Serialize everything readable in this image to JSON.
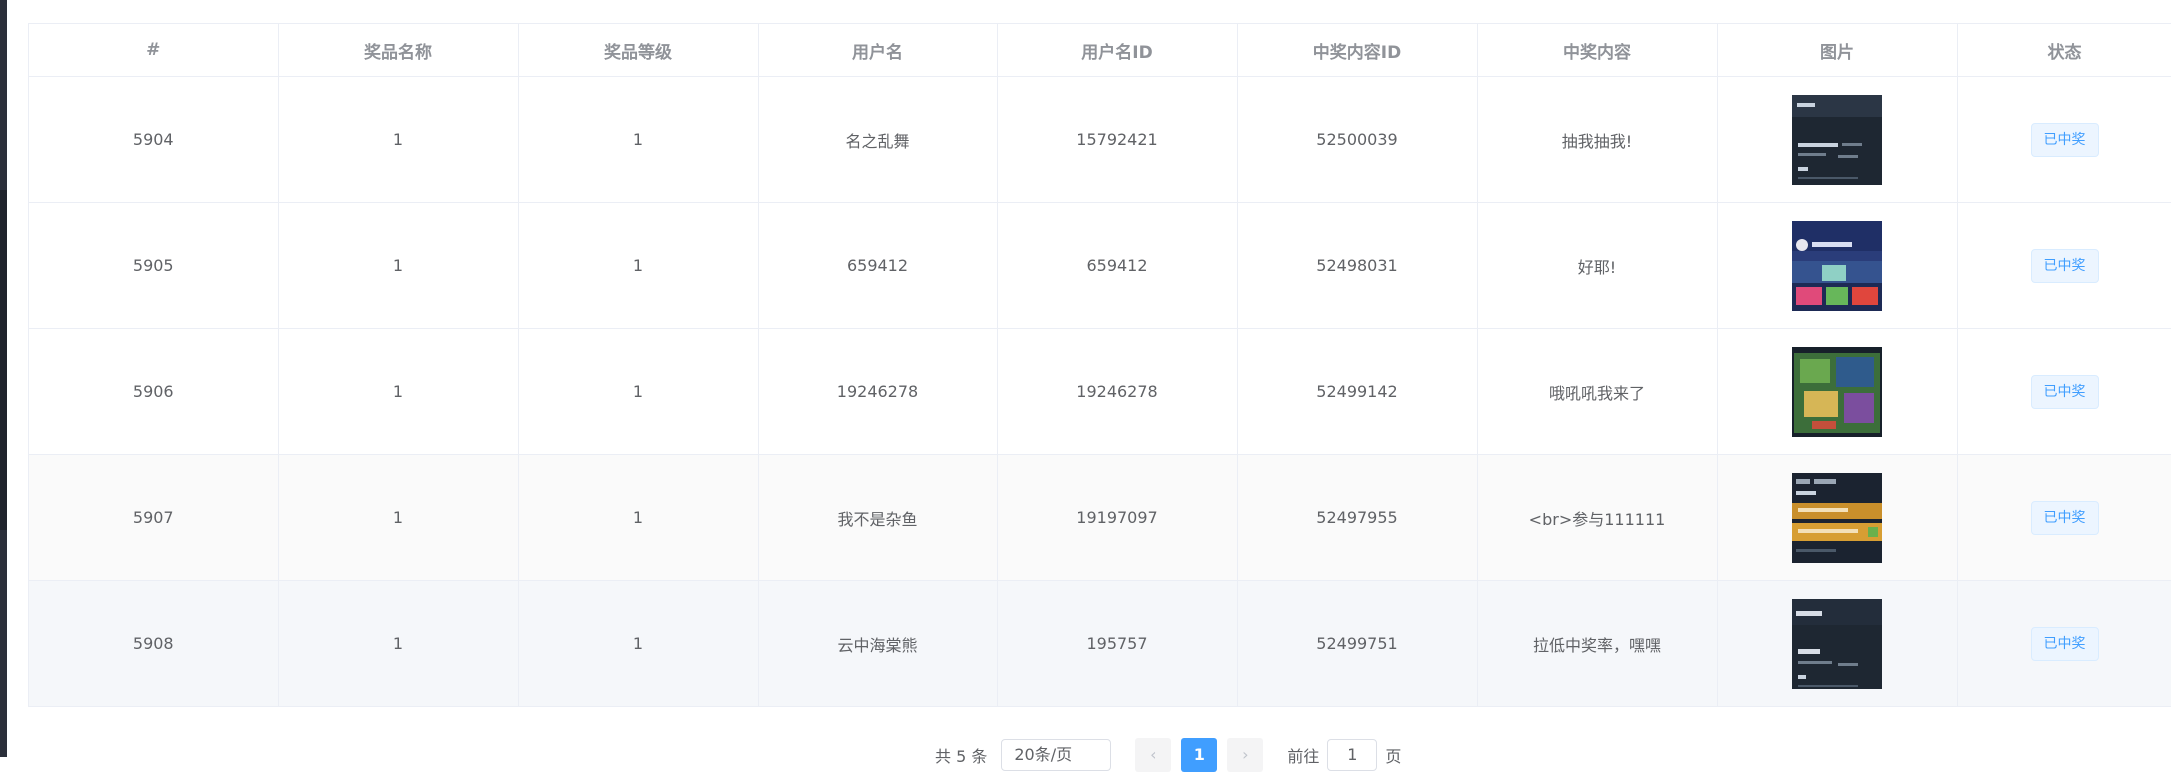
{
  "table": {
    "headers": [
      "#",
      "奖品名称",
      "奖品等级",
      "用户名",
      "用户名ID",
      "中奖内容ID",
      "中奖内容",
      "图片",
      "状态"
    ],
    "rows": [
      {
        "id": "5904",
        "prize_name": "1",
        "prize_level": "1",
        "username": "名之乱舞",
        "user_id": "15792421",
        "content_id": "52500039",
        "content": "抽我抽我!",
        "status": "已中奖"
      },
      {
        "id": "5905",
        "prize_name": "1",
        "prize_level": "1",
        "username": "659412",
        "user_id": "659412",
        "content_id": "52498031",
        "content": "好耶!",
        "status": "已中奖"
      },
      {
        "id": "5906",
        "prize_name": "1",
        "prize_level": "1",
        "username": "19246278",
        "user_id": "19246278",
        "content_id": "52499142",
        "content": "哦吼吼我来了",
        "status": "已中奖"
      },
      {
        "id": "5907",
        "prize_name": "1",
        "prize_level": "1",
        "username": "我不是杂鱼",
        "user_id": "19197097",
        "content_id": "52497955",
        "content": "<br>参与111111",
        "status": "已中奖"
      },
      {
        "id": "5908",
        "prize_name": "1",
        "prize_level": "1",
        "username": "云中海棠熊",
        "user_id": "195757",
        "content_id": "52499751",
        "content": "拉低中奖率，嘿嘿",
        "status": "已中奖"
      }
    ]
  },
  "pagination": {
    "total_text": "共 5 条",
    "page_size_text": "20条/页",
    "prev_icon": "chevron-left-icon",
    "current_page": "1",
    "next_icon": "chevron-right-icon",
    "goto_prefix": "前往",
    "goto_value": "1",
    "goto_suffix": "页"
  },
  "colors": {
    "accent": "#409eff",
    "tag_bg": "#ecf5ff",
    "border": "#ebeef5",
    "header_text": "#909399",
    "cell_text": "#606266"
  }
}
